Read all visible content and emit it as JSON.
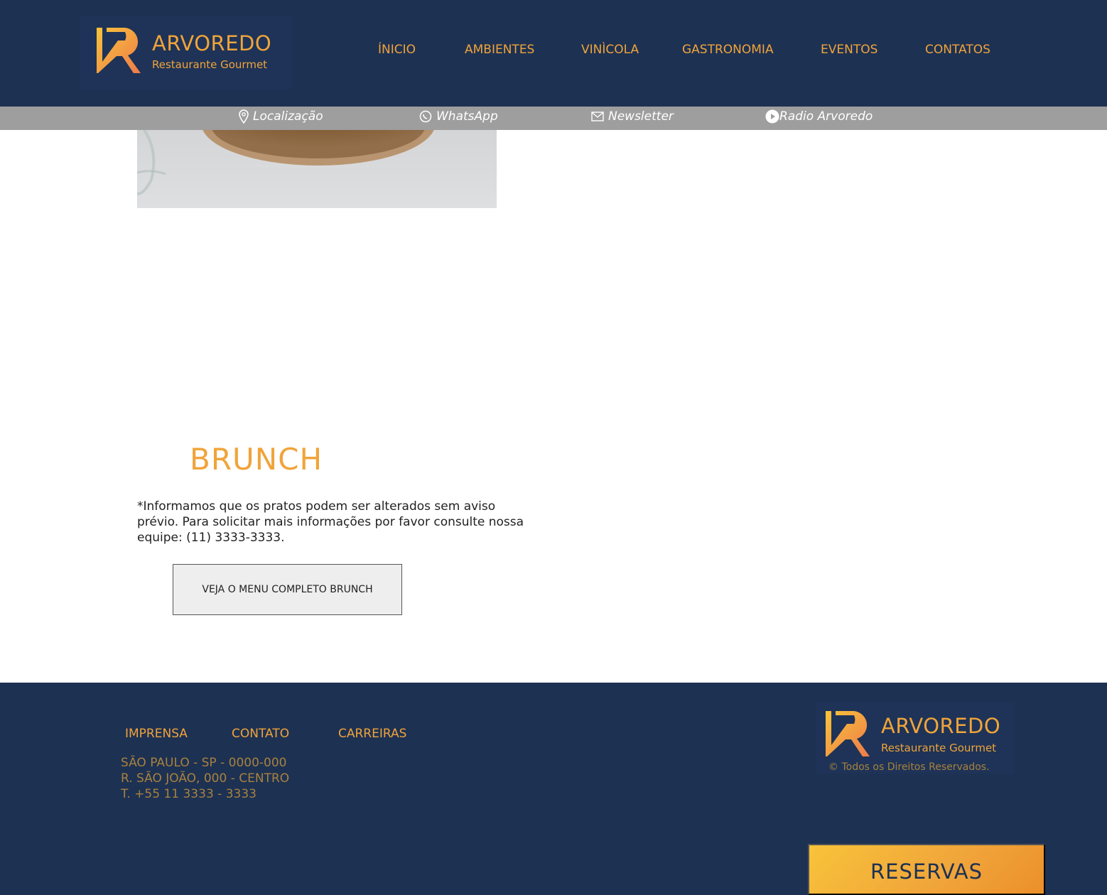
{
  "brand": {
    "name": "ARVOREDO",
    "tagline": "Restaurante Gourmet",
    "accent_color": "#f0a43a",
    "navy_color": "#1d3153"
  },
  "nav": {
    "items": [
      {
        "label": "ÍNICIO"
      },
      {
        "label": "AMBIENTES"
      },
      {
        "label": "VINÌCOLA"
      },
      {
        "label": "GASTRONOMIA"
      },
      {
        "label": "EVENTOS"
      },
      {
        "label": "CONTATOS"
      }
    ]
  },
  "subbar": {
    "items": [
      {
        "label": "Localização",
        "icon": "location-pin-icon"
      },
      {
        "label": "WhatsApp",
        "icon": "whatsapp-icon"
      },
      {
        "label": "Newsletter",
        "icon": "envelope-icon"
      },
      {
        "label": "Radio Arvoredo",
        "icon": "play-circle-icon"
      }
    ]
  },
  "main": {
    "title": "BRUNCH",
    "notice": "*Informamos que os pratos podem ser alterados sem aviso prévio. Para solicitar mais informações por favor consulte nossa equipe: (11) 3333-3333.",
    "menu_button": "VEJA O MENU COMPLETO BRUNCH"
  },
  "footer": {
    "links": [
      {
        "label": "IMPRENSA"
      },
      {
        "label": "CONTATO"
      },
      {
        "label": "CARREIRAS"
      }
    ],
    "address": {
      "line1": "SÃO PAULO - SP - 0000-000",
      "line2": "R. SÃO JOÃO, 000 - CENTRO",
      "line3": "T. +55 11 3333 - 3333"
    },
    "copyright": "© Todos os Direitos Reservados.",
    "reserve_button": "RESERVAS"
  }
}
